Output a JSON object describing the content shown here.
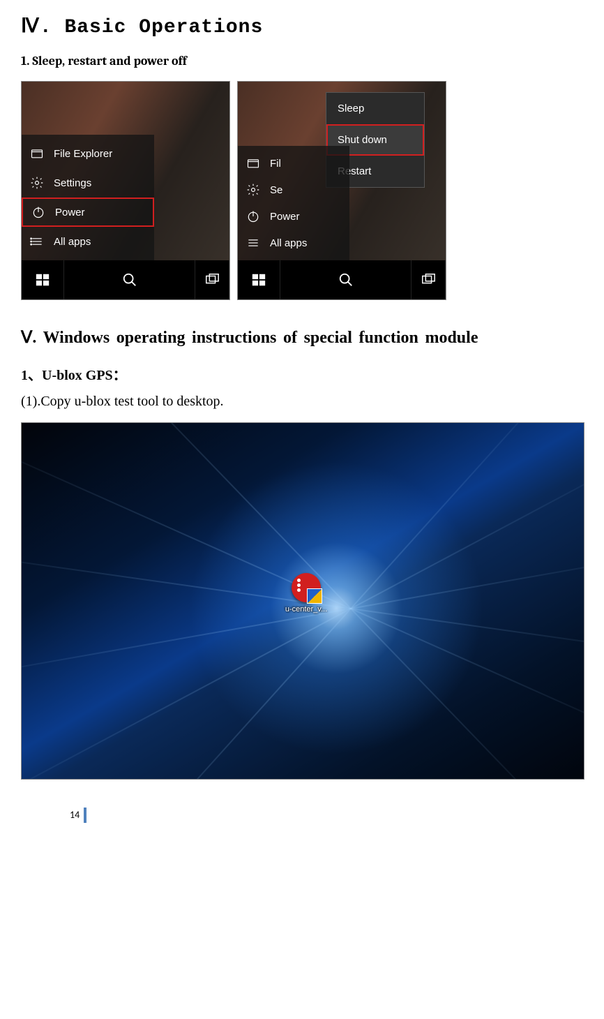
{
  "section4": {
    "title": "Ⅳ. Basic Operations"
  },
  "sub1": {
    "title": "1.  Sleep, restart and power off"
  },
  "startMenu": {
    "items": [
      {
        "icon": "file-explorer-icon",
        "label": "File Explorer"
      },
      {
        "icon": "gear-icon",
        "label": "Settings"
      },
      {
        "icon": "power-icon",
        "label": "Power"
      },
      {
        "icon": "all-apps-icon",
        "label": "All apps"
      }
    ],
    "itemsShort": [
      {
        "icon": "file-explorer-icon",
        "label": "Fil"
      },
      {
        "icon": "gear-icon",
        "label": "Se"
      },
      {
        "icon": "power-icon",
        "label": "Power"
      },
      {
        "icon": "all-apps-icon",
        "label": "All apps"
      }
    ]
  },
  "powerMenu": {
    "items": [
      "Sleep",
      "Shut down",
      "Restart"
    ],
    "highlight": "Shut down"
  },
  "section5": {
    "title": "Ⅴ. Windows  operating  instructions  of  special  function module"
  },
  "sub5_1": {
    "title": "1、U-blox   GPS："
  },
  "step5_1_1": "(1).Copy u-blox test tool to desktop.",
  "desktop": {
    "iconLabel": "u-center_v..."
  },
  "pageNumber": "14"
}
